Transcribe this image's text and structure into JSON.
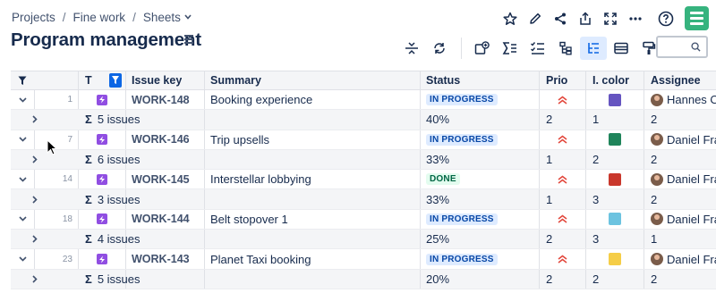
{
  "breadcrumb": {
    "items": [
      "Projects",
      "Fine work",
      "Sheets"
    ],
    "separator": "/"
  },
  "page": {
    "title": "Program management"
  },
  "colors": {
    "accent": "#0c66e4",
    "logo": "#36b37e",
    "type_icon": "#904ee2"
  },
  "top_actions": [
    "star-icon",
    "edit-icon",
    "share-icon",
    "export-icon",
    "fullscreen-icon",
    "more-icon",
    "help-icon"
  ],
  "toolbar": [
    "collapse-rows-icon",
    "refresh-icon",
    "add-view-icon",
    "sum-icon",
    "checklist-icon",
    "hierarchy-icon",
    "tree-icon",
    "row-height-icon",
    "format-painter-icon"
  ],
  "search": {
    "placeholder": ""
  },
  "columns": {
    "type": "T",
    "key": "Issue key",
    "summary": "Summary",
    "status": "Status",
    "prio": "Prio",
    "icolor": "I. color",
    "assignee": "Assignee"
  },
  "rows": [
    {
      "num": "1",
      "key": "WORK-148",
      "summary": "Booking experience",
      "status": "IN PROGRESS",
      "status_kind": "inprogress",
      "color": "#6554c0",
      "assignee": "Hannes O",
      "sub": {
        "label": "5 issues",
        "status": "40%",
        "prio": "2",
        "icolor": "1",
        "assignee": "2"
      }
    },
    {
      "num": "7",
      "key": "WORK-146",
      "summary": "Trip upsells",
      "status": "IN PROGRESS",
      "status_kind": "inprogress",
      "color": "#1f845a",
      "assignee": "Daniel Fra",
      "sub": {
        "label": "6 issues",
        "status": "33%",
        "prio": "1",
        "icolor": "2",
        "assignee": "2"
      }
    },
    {
      "num": "14",
      "key": "WORK-145",
      "summary": "Interstellar lobbying",
      "status": "DONE",
      "status_kind": "done",
      "color": "#c9372c",
      "assignee": "Daniel Fra",
      "sub": {
        "label": "3 issues",
        "status": "33%",
        "prio": "1",
        "icolor": "3",
        "assignee": "2"
      }
    },
    {
      "num": "18",
      "key": "WORK-144",
      "summary": "Belt stopover 1",
      "status": "IN PROGRESS",
      "status_kind": "inprogress",
      "color": "#6cc3e0",
      "assignee": "Daniel Fra",
      "sub": {
        "label": "4 issues",
        "status": "25%",
        "prio": "2",
        "icolor": "3",
        "assignee": "1"
      }
    },
    {
      "num": "23",
      "key": "WORK-143",
      "summary": "Planet Taxi booking",
      "status": "IN PROGRESS",
      "status_kind": "inprogress",
      "color": "#f5cd47",
      "assignee": "Daniel Fra",
      "sub": {
        "label": "5 issues",
        "status": "20%",
        "prio": "2",
        "icolor": "2",
        "assignee": "2"
      }
    }
  ]
}
